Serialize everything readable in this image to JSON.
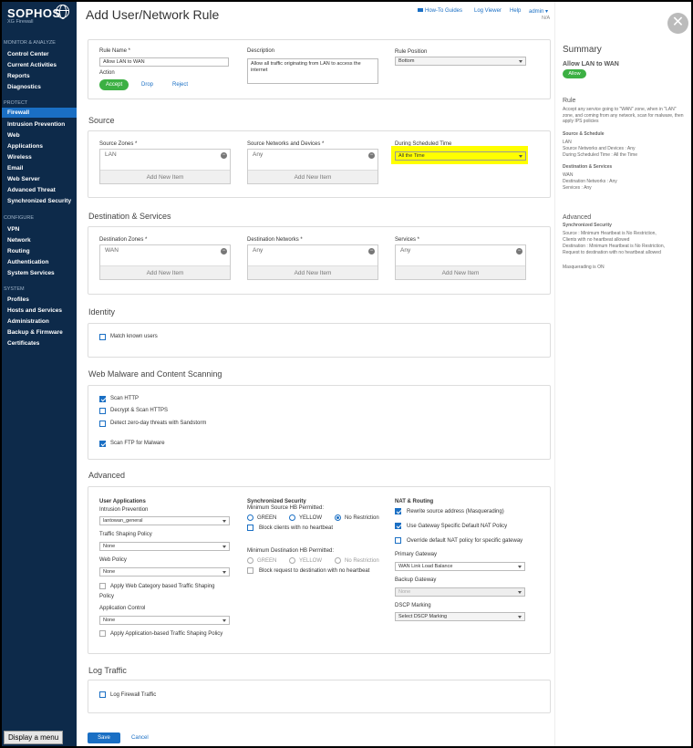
{
  "sidebar": {
    "brand": "SOPHOS",
    "product": "XG Firewall",
    "sections": [
      {
        "title": "MONITOR & ANALYZE",
        "items": [
          "Control Center",
          "Current Activities",
          "Reports",
          "Diagnostics"
        ]
      },
      {
        "title": "PROTECT",
        "items": [
          "Firewall",
          "Intrusion Prevention",
          "Web",
          "Applications",
          "Wireless",
          "Email",
          "Web Server",
          "Advanced Threat",
          "Synchronized Security"
        ]
      },
      {
        "title": "CONFIGURE",
        "items": [
          "VPN",
          "Network",
          "Routing",
          "Authentication",
          "System Services"
        ]
      },
      {
        "title": "SYSTEM",
        "items": [
          "Profiles",
          "Hosts and Services",
          "Administration",
          "Backup & Firmware",
          "Certificates"
        ]
      }
    ],
    "display_menu": "Display a menu"
  },
  "header": {
    "title": "Add User/Network Rule",
    "links": {
      "how_to": "How-To Guides",
      "log_viewer": "Log Viewer",
      "help": "Help",
      "admin": "admin"
    },
    "admin_sub": "N/A"
  },
  "rule": {
    "name_label": "Rule Name *",
    "name_value": "Allow LAN to WAN",
    "action_label": "Action",
    "action_accept": "Accept",
    "action_drop": "Drop",
    "action_reject": "Reject",
    "desc_label": "Description",
    "desc_value": "Allow all traffic originating from LAN to access the internet",
    "position_label": "Rule Position",
    "position_value": "Bottom"
  },
  "source": {
    "title": "Source",
    "zones_label": "Source Zones *",
    "zones_value": "LAN",
    "networks_label": "Source Networks and Devices *",
    "networks_value": "Any",
    "schedule_label": "During Scheduled Time",
    "schedule_value": "All the Time",
    "add_new": "Add New Item"
  },
  "destination": {
    "title": "Destination & Services",
    "zones_label": "Destination Zones *",
    "zones_value": "WAN",
    "networks_label": "Destination Networks *",
    "networks_value": "Any",
    "services_label": "Services *",
    "services_value": "Any",
    "add_new": "Add New Item"
  },
  "identity": {
    "title": "Identity",
    "match_known": "Match known users"
  },
  "malware": {
    "title": "Web Malware and Content Scanning",
    "scan_http": "Scan HTTP",
    "decrypt": "Decrypt & Scan HTTPS",
    "zero_day": "Detect zero-day threats with Sandstorm",
    "scan_ftp": "Scan FTP for Malware"
  },
  "advanced": {
    "title": "Advanced",
    "user_apps": "User Applications",
    "ips_label": "Intrusion Prevention",
    "ips_value": "lantowan_general",
    "tsp_label": "Traffic Shaping Policy",
    "tsp_value": "None",
    "web_label": "Web Policy",
    "web_value": "None",
    "apply_web": "Apply Web Category based Traffic Shaping",
    "apply_web_2": "Policy",
    "app_label": "Application Control",
    "app_value": "None",
    "apply_app": "Apply Application-based Traffic Shaping Policy",
    "sync_title": "Synchronized Security",
    "min_source": "Minimum Source HB Permitted:",
    "green": "GREEN",
    "yellow": "YELLOW",
    "no_restriction": "No Restriction",
    "block_clients": "Block clients with no heartbeat",
    "min_dest": "Minimum Destination HB Permitted:",
    "block_request": "Block request to destination with no heartbeat",
    "nat_title": "NAT & Routing",
    "rewrite": "Rewrite source address (Masquerading)",
    "use_gateway": "Use Gateway Specific Default NAT Policy",
    "override": "Override default NAT policy for specific gateway",
    "primary_gw_label": "Primary Gateway",
    "primary_gw_value": "WAN Link Load Balance",
    "backup_gw_label": "Backup Gateway",
    "backup_gw_value": "None",
    "dscp_label": "DSCP Marking",
    "dscp_value": "Select DSCP Marking"
  },
  "log": {
    "title": "Log Traffic",
    "log_fw": "Log Firewall Traffic"
  },
  "footer": {
    "save": "Save",
    "cancel": "Cancel"
  },
  "summary": {
    "title": "Summary",
    "rule_name": "Allow LAN to WAN",
    "badge": "Allow",
    "rule_heading": "Rule",
    "rule_text": "Accept any service going to \"WAN\" zone, when in \"LAN\" zone, and coming from any network, scan for malware, then apply IPS policies",
    "ss_heading": "Source & Schedule",
    "ss_lines": [
      "LAN",
      "Source Networks and Devices : Any",
      "During Scheduled Time : All the Time"
    ],
    "ds_heading": "Destination & Services",
    "ds_lines": [
      "WAN",
      "Destination Networks : Any",
      "Services : Any"
    ],
    "adv_heading": "Advanced",
    "sync_heading": "Synchronized Security",
    "sync_lines": [
      "Source : Minimum Heartbeat is No Restriction,",
      "Clients with no heartbeat allowed",
      "Destination : Minimum Heartbeat is No Restriction,",
      "Request to destination with no heartbeat allowed"
    ],
    "masq": "Masquerading is ON"
  },
  "colors": {
    "sidebar_bg": "#0d2a4a",
    "accent": "#1a6fc4",
    "accept_green": "#3cb043",
    "highlight": "#ffff00"
  }
}
